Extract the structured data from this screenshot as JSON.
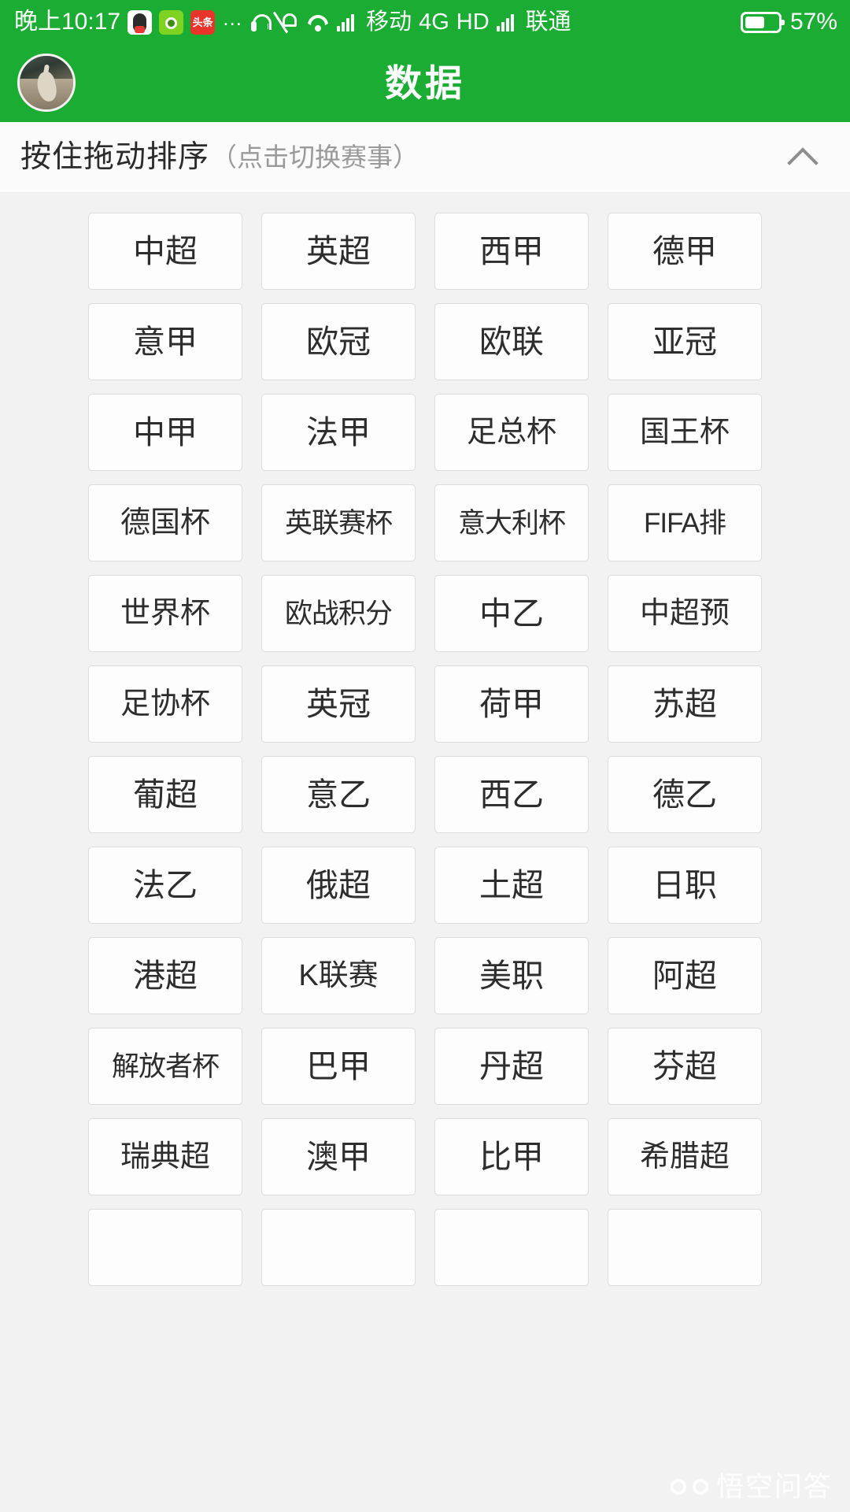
{
  "status_bar": {
    "clock": "晚上10:17",
    "app_icons": [
      "qq-icon",
      "green-app-icon",
      "toutiao-icon"
    ],
    "toutiao_label": "头条",
    "overflow": "…",
    "icons": [
      "headset-icon",
      "bell-muted-icon",
      "wifi-icon",
      "signal-icon-1"
    ],
    "carrier_1": "移动",
    "network": "4G",
    "hd_label": "HD",
    "signal_2": "signal-icon-2",
    "carrier_2": "联通",
    "battery_icon": "battery-icon",
    "battery_percent": "57%"
  },
  "app_bar": {
    "avatar": "user-avatar",
    "title": "数据"
  },
  "sort_header": {
    "main_label": "按住拖动排序",
    "sub_label": "（点击切换赛事）",
    "collapse_icon": "chevron-up-icon"
  },
  "leagues": [
    "中超",
    "英超",
    "西甲",
    "德甲",
    "意甲",
    "欧冠",
    "欧联",
    "亚冠",
    "中甲",
    "法甲",
    "足总杯",
    "国王杯",
    "德国杯",
    "英联赛杯",
    "意大利杯",
    "FIFA排",
    "世界杯",
    "欧战积分",
    "中乙",
    "中超预",
    "足协杯",
    "英冠",
    "荷甲",
    "苏超",
    "葡超",
    "意乙",
    "西乙",
    "德乙",
    "法乙",
    "俄超",
    "土超",
    "日职",
    "港超",
    "K联赛",
    "美职",
    "阿超",
    "解放者杯",
    "巴甲",
    "丹超",
    "芬超",
    "瑞典超",
    "澳甲",
    "比甲",
    "希腊超",
    "",
    "",
    "",
    ""
  ],
  "watermark": {
    "logo": "wukong-logo",
    "text": "悟空问答"
  },
  "colors": {
    "brand_green": "#1bac33",
    "page_bg": "#f2f2f2",
    "tile_bg": "#fdfdfd",
    "tile_border": "#dcdcdc",
    "text_primary": "#2d2d2d",
    "text_muted": "#9a9a9a"
  }
}
